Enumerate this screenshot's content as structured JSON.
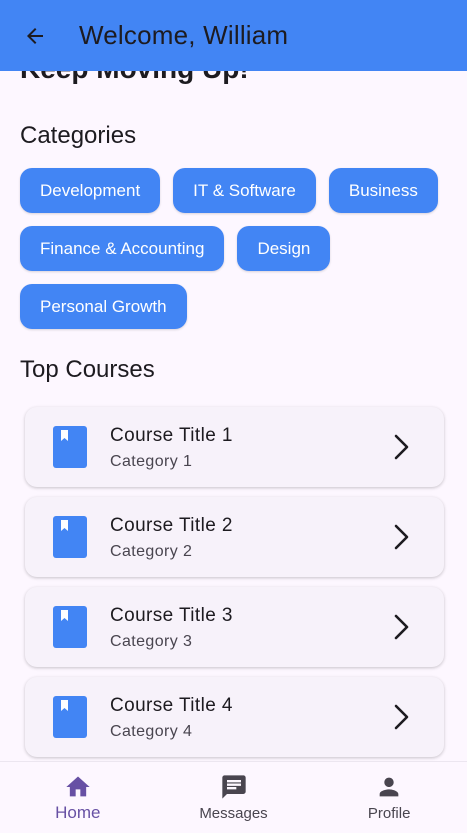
{
  "appbar": {
    "title": "Welcome, William",
    "back_icon": "arrow-back-icon",
    "background": "#4285F4"
  },
  "banner": {
    "text": "Keep Moving Up!"
  },
  "categories": {
    "title": "Categories",
    "items": [
      "Development",
      "IT & Software",
      "Business",
      "Finance & Accounting",
      "Design",
      "Personal Growth"
    ]
  },
  "top_courses": {
    "title": "Top Courses",
    "items": [
      {
        "title": "Course Title 1",
        "category": "Category 1",
        "icon": "book-icon",
        "action_icon": "chevron-right-icon"
      },
      {
        "title": "Course Title 2",
        "category": "Category 2",
        "icon": "book-icon",
        "action_icon": "chevron-right-icon"
      },
      {
        "title": "Course Title 3",
        "category": "Category 3",
        "icon": "book-icon",
        "action_icon": "chevron-right-icon"
      },
      {
        "title": "Course Title 4",
        "category": "Category 4",
        "icon": "book-icon",
        "action_icon": "chevron-right-icon"
      }
    ]
  },
  "bottom_nav": {
    "items": [
      {
        "label": "Home",
        "icon": "home-icon",
        "active": true
      },
      {
        "label": "Messages",
        "icon": "messages-icon",
        "active": false
      },
      {
        "label": "Profile",
        "icon": "person-icon",
        "active": false
      }
    ],
    "active_color": "#6750A4",
    "inactive_color": "#49454F"
  },
  "colors": {
    "accent": "#4285F4",
    "background": "#FDF7FF",
    "card": "#F7F2FA"
  }
}
